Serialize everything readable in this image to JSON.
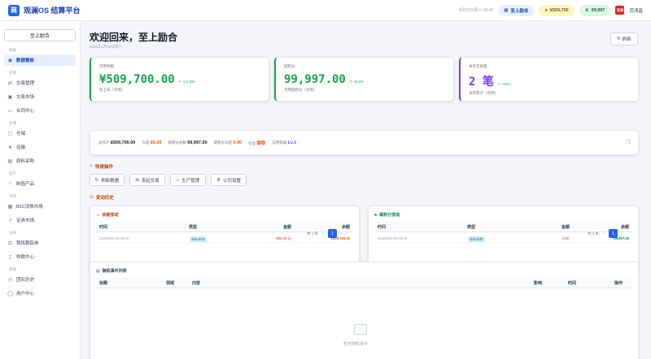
{
  "app": {
    "logo": "商",
    "title": "观澜OS 结算平台"
  },
  "topbar": {
    "clock": "8月29日周六 09:48",
    "badges": [
      {
        "icon": "building-icon",
        "label": "至上励合"
      },
      {
        "icon": "coin-icon",
        "label": "¥509,700"
      },
      {
        "icon": "trophy-icon",
        "label": "99,997"
      }
    ],
    "avatar": "范涛",
    "username": "范涛昌"
  },
  "sidebar": {
    "user": "至上励合",
    "groups": [
      {
        "title": "数据",
        "items": [
          {
            "icon": "dashboard-icon",
            "label": "数据看板",
            "active": true
          }
        ]
      },
      {
        "title": "交易",
        "items": [
          {
            "icon": "exchange-icon",
            "label": "交易管理"
          },
          {
            "icon": "market-icon",
            "label": "交易市场"
          },
          {
            "icon": "contract-icon",
            "label": "合同中心"
          }
        ]
      },
      {
        "title": "仓储",
        "items": [
          {
            "icon": "warehouse-icon",
            "label": "仓储"
          },
          {
            "icon": "truck-icon",
            "label": "运输"
          },
          {
            "icon": "purchase-icon",
            "label": "原料采购"
          }
        ]
      },
      {
        "title": "生产",
        "items": [
          {
            "icon": "factory-icon",
            "label": "制造产品"
          }
        ]
      },
      {
        "title": "市场",
        "items": [
          {
            "icon": "b2c-icon",
            "label": "B2C消费市场"
          },
          {
            "icon": "stock-icon",
            "label": "证券市场"
          }
        ]
      },
      {
        "title": "法律",
        "items": [
          {
            "icon": "lawsuit-icon",
            "label": "我挥跟踪单"
          },
          {
            "icon": "arbitration-icon",
            "label": "仲裁中心"
          }
        ]
      },
      {
        "title": "其他",
        "items": [
          {
            "icon": "history-icon",
            "label": "团队历史"
          },
          {
            "icon": "user-icon",
            "label": "用户中心"
          }
        ]
      }
    ]
  },
  "header": {
    "title": "欢迎回来，至上励合",
    "subtitle": "2026年8月29日周六",
    "refresh": "刷新"
  },
  "stats": [
    {
      "label": "可用余额",
      "value": "¥509,700.00",
      "change": "+12.5%",
      "note": "较上日（示例）",
      "color": "#16a34a"
    },
    {
      "label": "碳积分",
      "value": "99,997.00",
      "change": "+8.2%",
      "note": "可用碳积分（示例）",
      "color": "#16a34a"
    },
    {
      "label": "本月交易量",
      "value": "2 笔",
      "change": "+15%",
      "note": "本月累计（示例）",
      "color": "#7c3aed"
    }
  ],
  "info": {
    "items": [
      {
        "label": "总资产",
        "value": "¥509,700.00",
        "color": "#111827"
      },
      {
        "label": "冻结",
        "value": "¥0.00",
        "color": "#ea580c"
      },
      {
        "label": "碳积分总额",
        "value": "99,997.00",
        "color": "#111827"
      },
      {
        "label": "碳积分冻结",
        "value": "0.00",
        "color": "#ea580c"
      },
      {
        "label": "行业",
        "value": "钢铁",
        "color": "#ea580c"
      },
      {
        "label": "信用等级",
        "value": "Lv.1",
        "color": "#7c3aed"
      }
    ]
  },
  "quick": {
    "title": "快速操作",
    "buttons": [
      {
        "icon": "refresh-icon",
        "label": "刷新数据"
      },
      {
        "icon": "swap-icon",
        "label": "发起交易"
      },
      {
        "icon": "factory-icon",
        "label": "生产管理"
      },
      {
        "icon": "gear-icon",
        "label": "公司设置"
      }
    ]
  },
  "history": {
    "title": "变动历史",
    "balance": {
      "title": "余额变动",
      "cols": [
        "时间",
        "类型",
        "金额",
        "余额"
      ],
      "rows": [
        {
          "time": "2026/8/29 09:43:06",
          "type": "原料采购",
          "amount": "-300.00 元",
          "balance": "¥509,700.00"
        }
      ],
      "total": "共 1 条",
      "page": "1"
    },
    "carbon": {
      "title": "碳积分变动",
      "cols": [
        "时间",
        "类型",
        "金额",
        "余额"
      ],
      "rows": [
        {
          "time": "2026/8/29 09:43:06",
          "type": "原料采购",
          "amount": "-3.00",
          "balance": "99,997.00"
        }
      ],
      "total": "共 1 条",
      "page": "1"
    }
  },
  "events": {
    "title": "随机事件列表",
    "cols": [
      "标题",
      "领域",
      "内容",
      "影响",
      "时间",
      "操作"
    ],
    "empty": "暂无随机事件"
  }
}
